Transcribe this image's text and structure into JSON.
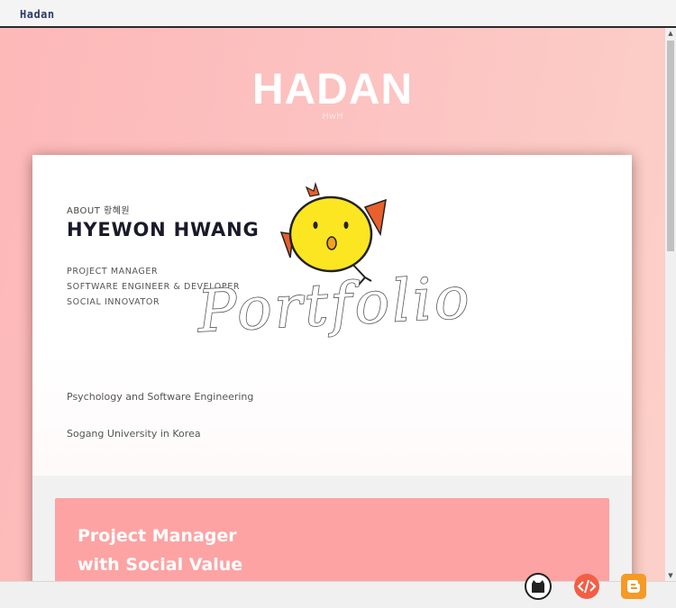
{
  "brand": "Hadan",
  "hero": {
    "title": "HADAN",
    "subtitle": "HwH"
  },
  "about": {
    "label": "ABOUT 황혜원",
    "name": "HYEWON HWANG",
    "roles": [
      "PROJECT MANAGER",
      "SOFTWARE ENGINEER & DEVELOPER",
      "SOCIAL INNOVATOR"
    ],
    "education": [
      "Psychology and Software Engineering",
      "Sogang University in Korea"
    ]
  },
  "logo": {
    "text": "Portfolio"
  },
  "section": {
    "lines": [
      "Project Manager",
      "with Social Value"
    ]
  },
  "links": {
    "github": "github-icon",
    "code": "code-icon",
    "blogger": "blogger-icon"
  },
  "colors": {
    "accent": "#fda3a3",
    "hero_bg": "#fcc4c2"
  }
}
